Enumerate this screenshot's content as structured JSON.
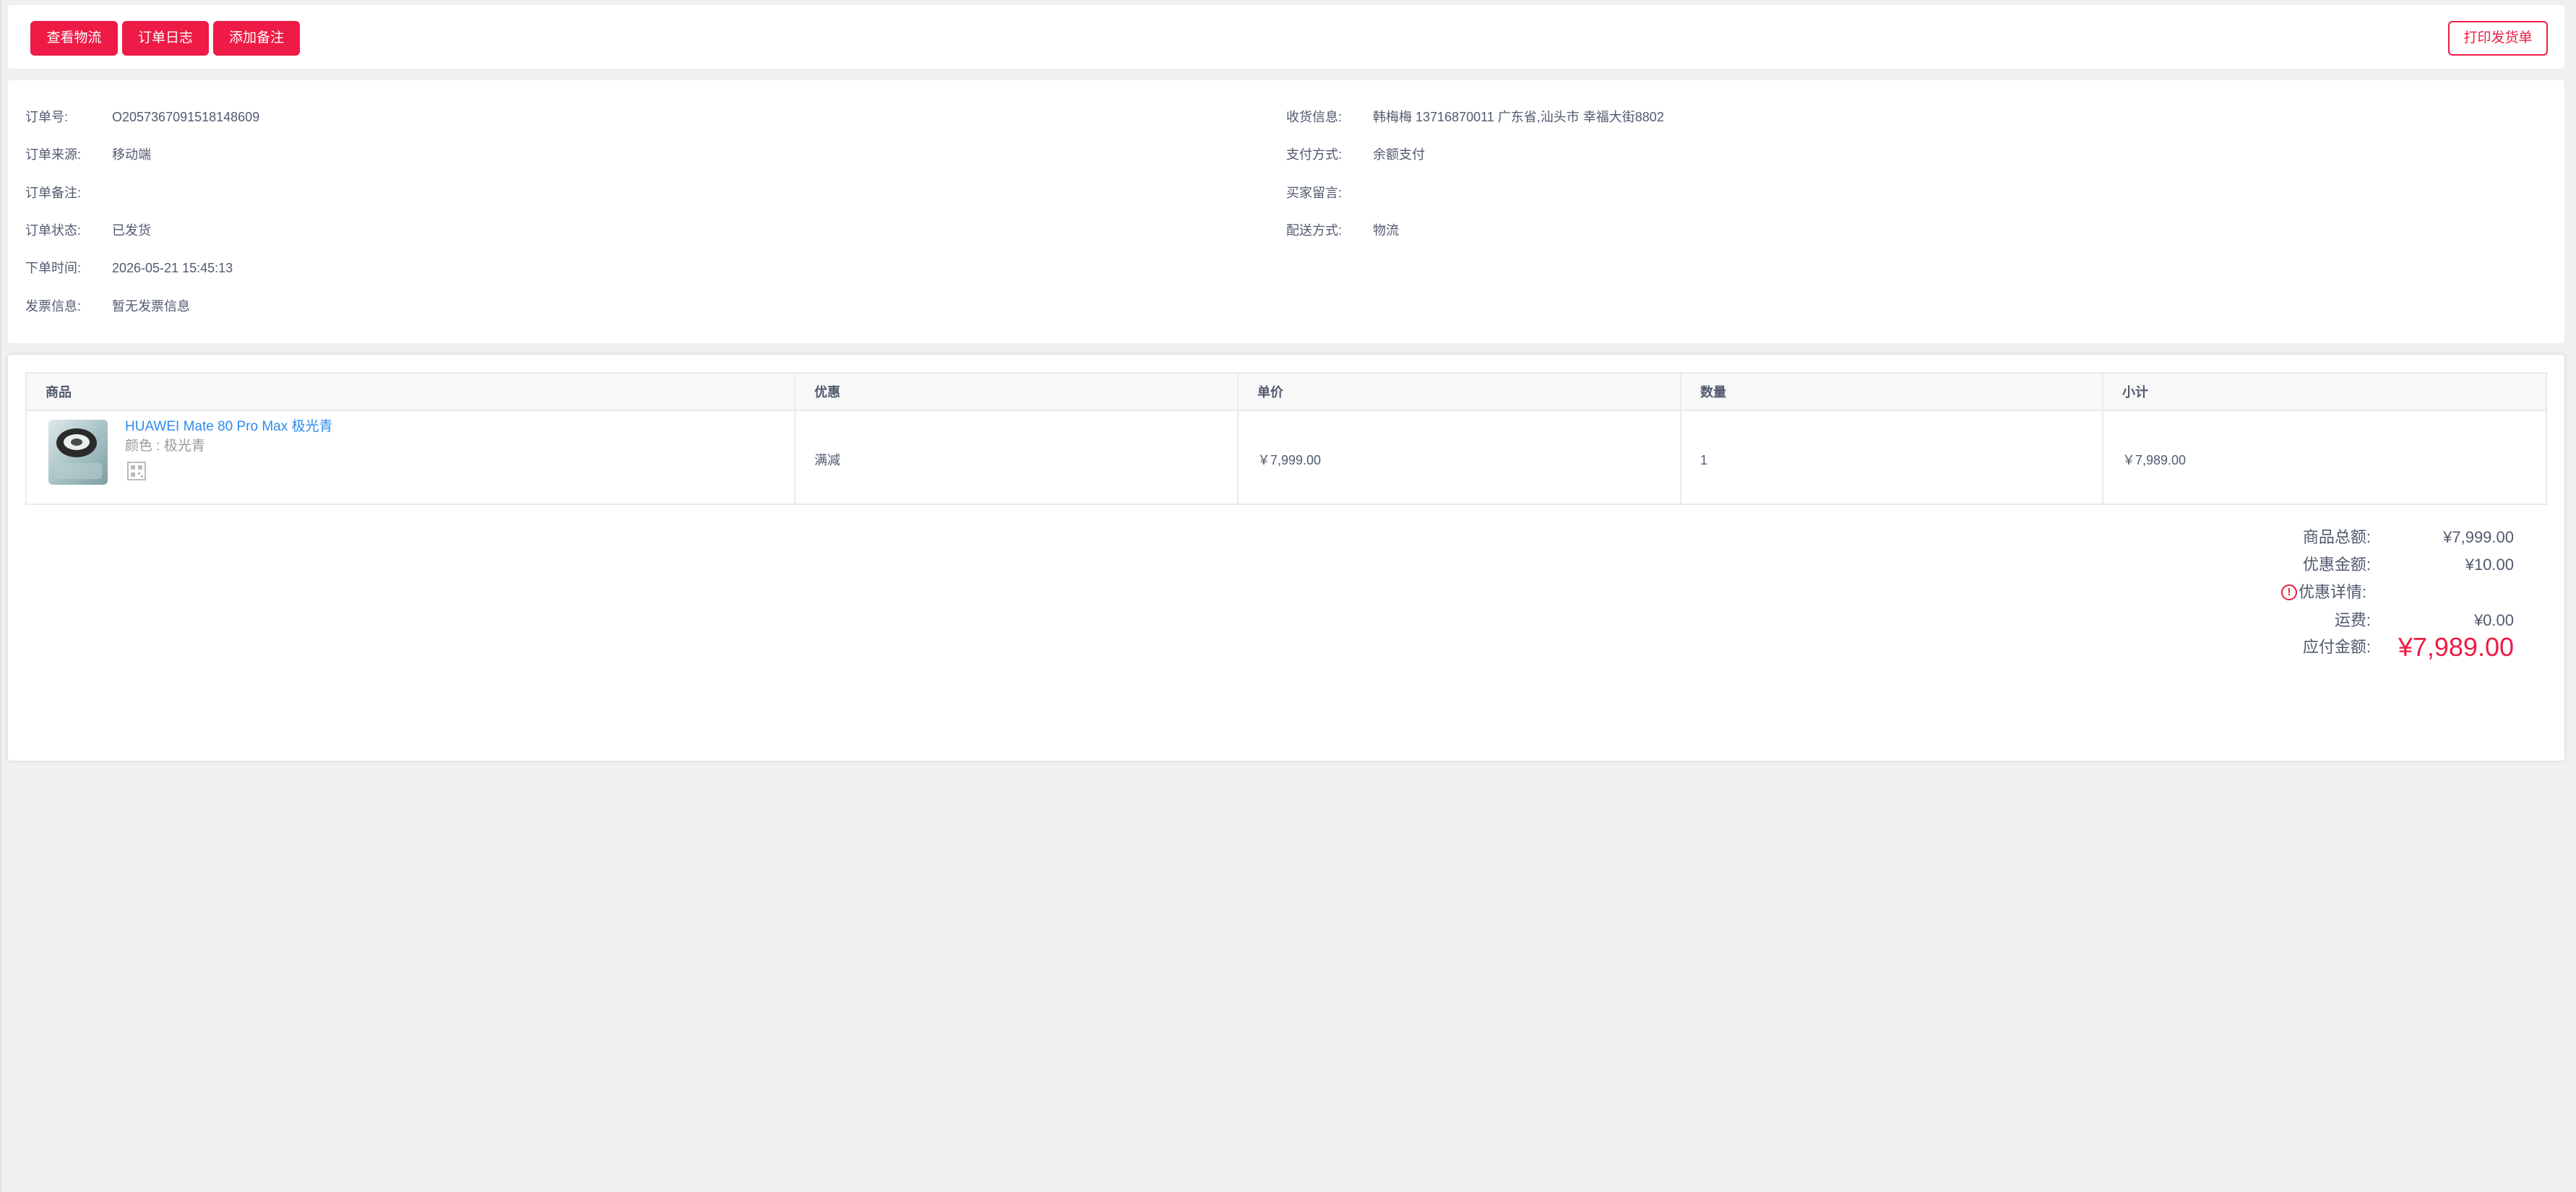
{
  "toolbar": {
    "view_logistics": "查看物流",
    "order_log": "订单日志",
    "add_note": "添加备注",
    "print_invoice": "打印发货单"
  },
  "order_info": {
    "left": [
      {
        "label": "订单号:",
        "value": "O2057367091518148609"
      },
      {
        "label": "订单来源:",
        "value": "移动端"
      },
      {
        "label": "订单备注:",
        "value": ""
      },
      {
        "label": "订单状态:",
        "value": "已发货"
      },
      {
        "label": "下单时间:",
        "value": "2026-05-21 15:45:13"
      },
      {
        "label": "发票信息:",
        "value": "暂无发票信息"
      }
    ],
    "right": [
      {
        "label": "收货信息:",
        "value": "韩梅梅 13716870011 广东省,汕头市 幸福大街8802"
      },
      {
        "label": "支付方式:",
        "value": "余额支付"
      },
      {
        "label": "买家留言:",
        "value": ""
      },
      {
        "label": "配送方式:",
        "value": "物流"
      }
    ]
  },
  "product_table": {
    "headers": [
      "商品",
      "优惠",
      "单价",
      "数量",
      "小计"
    ],
    "rows": [
      {
        "name": "HUAWEI Mate 80 Pro Max 极光青",
        "spec": "颜色 : 极光青",
        "discount": "满减",
        "unit_price": "￥7,999.00",
        "quantity": "1",
        "subtotal": "￥7,989.00"
      }
    ]
  },
  "summary": {
    "goods_total_label": "商品总额:",
    "goods_total_value": "¥7,999.00",
    "discount_label": "优惠金额:",
    "discount_value": "¥10.00",
    "discount_detail_label": "优惠详情:",
    "shipping_label": "运费:",
    "shipping_value": "¥0.00",
    "payable_label": "应付金额:",
    "payable_value": "¥7,989.00"
  },
  "colors": {
    "primary": "#ed1b45",
    "link": "#2d8cf0",
    "text": "#515a6e",
    "background": "#f0f0f0"
  }
}
